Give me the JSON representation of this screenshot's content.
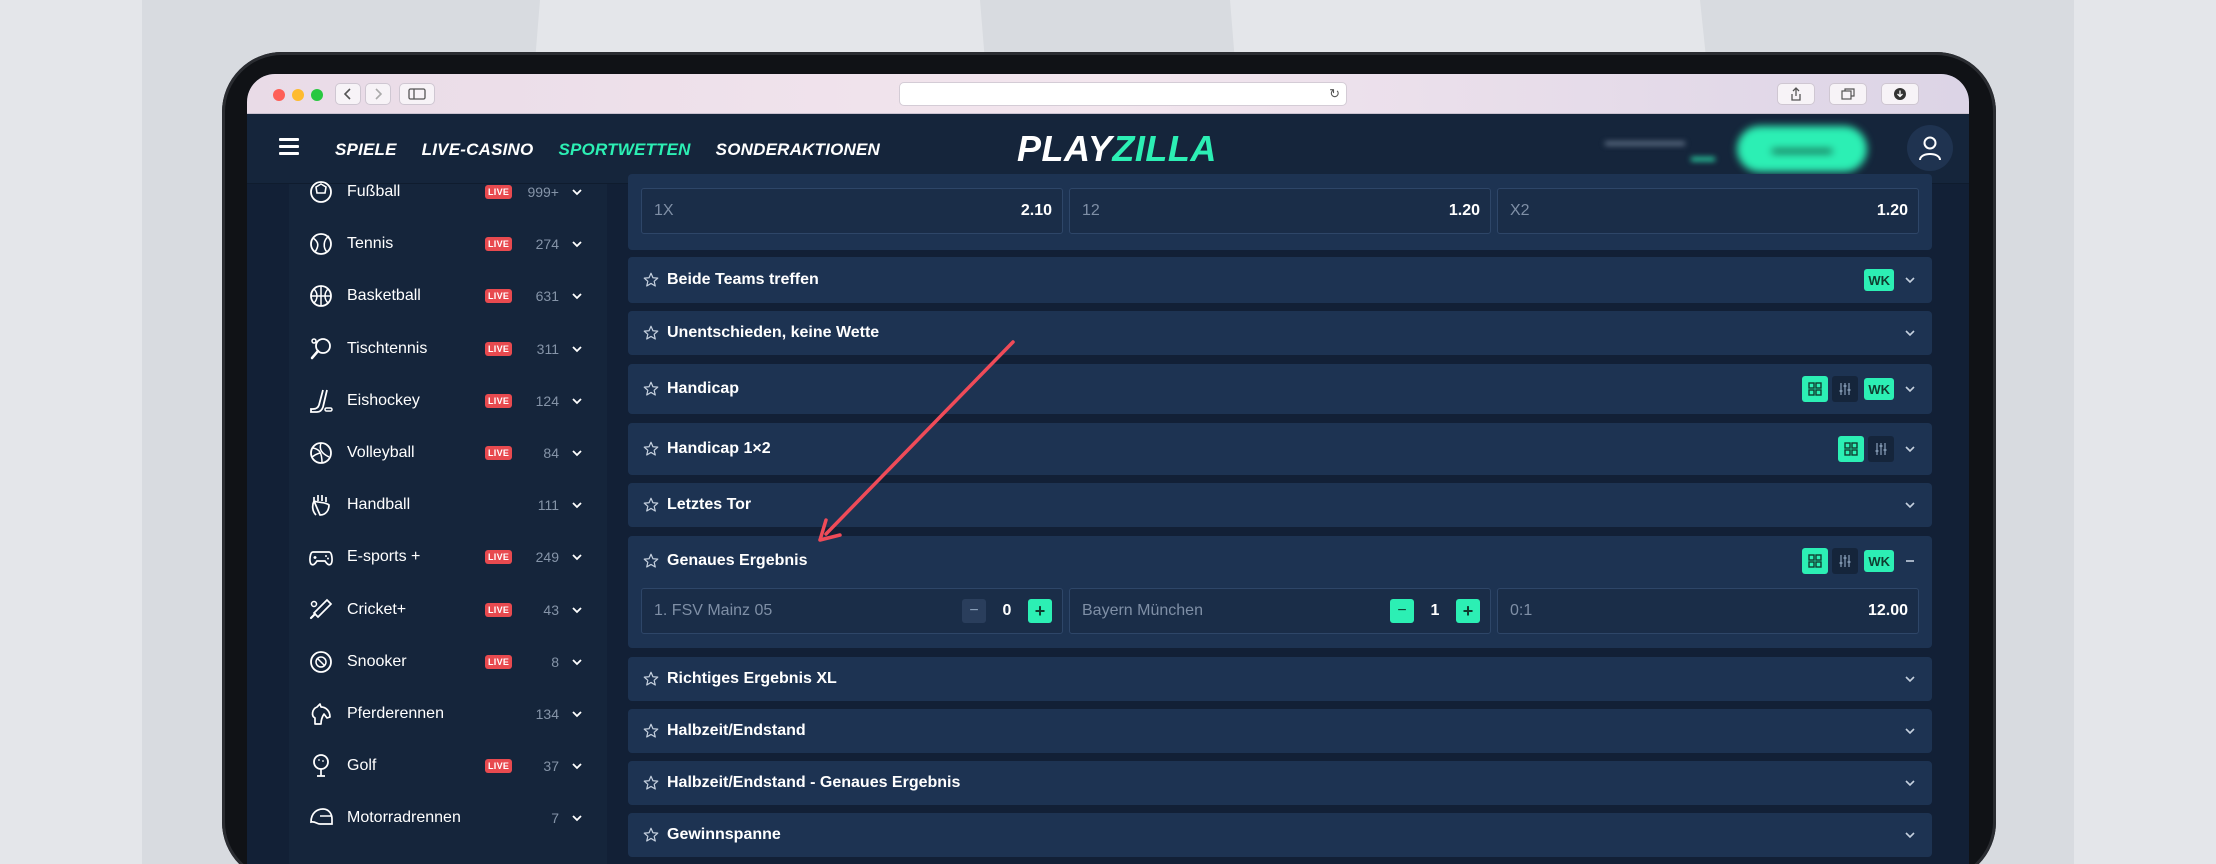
{
  "colors": {
    "accent": "#2cefb4",
    "live": "#e84a4f",
    "background": "#15253b",
    "panel": "#1d3352",
    "arrow": "#ef4b58"
  },
  "nav": {
    "menu": [
      {
        "label": "SPIELE",
        "active": false
      },
      {
        "label": "LIVE-CASINO",
        "active": false
      },
      {
        "label": "SPORTWETTEN",
        "active": true
      },
      {
        "label": "SONDERAKTIONEN",
        "active": false
      }
    ],
    "logo_white": "PLAY",
    "logo_green": "ZILLA"
  },
  "sidebar": {
    "items": [
      {
        "label": "Fußball",
        "live": "LIVE",
        "count": "999+",
        "icon": "football-icon"
      },
      {
        "label": "Tennis",
        "live": "LIVE",
        "count": "274",
        "icon": "tennis-icon"
      },
      {
        "label": "Basketball",
        "live": "LIVE",
        "count": "631",
        "icon": "basketball-icon"
      },
      {
        "label": "Tischtennis",
        "live": "LIVE",
        "count": "311",
        "icon": "table-tennis-icon"
      },
      {
        "label": "Eishockey",
        "live": "LIVE",
        "count": "124",
        "icon": "ice-hockey-icon"
      },
      {
        "label": "Volleyball",
        "live": "LIVE",
        "count": "84",
        "icon": "volleyball-icon"
      },
      {
        "label": "Handball",
        "live": "",
        "count": "111",
        "icon": "handball-icon"
      },
      {
        "label": "E-sports +",
        "live": "LIVE",
        "count": "249",
        "icon": "gamepad-icon"
      },
      {
        "label": "Cricket+",
        "live": "LIVE",
        "count": "43",
        "icon": "cricket-icon"
      },
      {
        "label": "Snooker",
        "live": "LIVE",
        "count": "8",
        "icon": "snooker-icon"
      },
      {
        "label": "Pferderennen",
        "live": "",
        "count": "134",
        "icon": "horse-icon"
      },
      {
        "label": "Golf",
        "live": "LIVE",
        "count": "37",
        "icon": "golf-icon"
      },
      {
        "label": "Motorradrennen",
        "live": "",
        "count": "7",
        "icon": "helmet-icon"
      }
    ]
  },
  "markets": {
    "double_chance": {
      "odds": [
        {
          "label": "1X",
          "value": "2.10"
        },
        {
          "label": "12",
          "value": "1.20"
        },
        {
          "label": "X2",
          "value": "1.20"
        }
      ]
    },
    "list": [
      {
        "title": "Beide Teams treffen",
        "wk": "WK"
      },
      {
        "title": "Unentschieden, keine Wette"
      },
      {
        "title": "Handicap",
        "wk": "WK"
      },
      {
        "title": "Handicap 1×2"
      },
      {
        "title": "Letztes Tor"
      },
      {
        "title": "Genaues Ergebnis",
        "wk": "WK"
      },
      {
        "title": "Richtiges Ergebnis XL"
      },
      {
        "title": "Halbzeit/Endstand"
      },
      {
        "title": "Halbzeit/Endstand - Genaues Ergebnis"
      },
      {
        "title": "Gewinnspanne"
      }
    ],
    "exact_score": {
      "home_team": "1. FSV Mainz 05",
      "home_goals": "0",
      "away_team": "Bayern München",
      "away_goals": "1",
      "score_label": "0:1",
      "score_odds": "12.00"
    }
  }
}
